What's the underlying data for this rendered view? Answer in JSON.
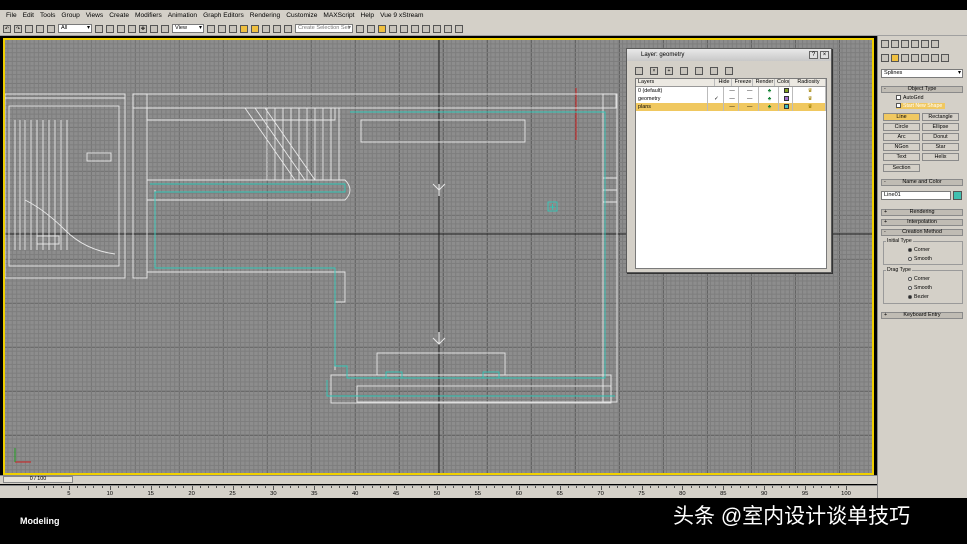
{
  "menu": [
    "File",
    "Edit",
    "Tools",
    "Group",
    "Views",
    "Create",
    "Modifiers",
    "Animation",
    "Graph Editors",
    "Rendering",
    "Customize",
    "MAXScript",
    "Help",
    "Vue 9 xStream"
  ],
  "toolbar": {
    "filter_value": "All",
    "viewcoord_value": "View",
    "selection_set_placeholder": "Create Selection Set"
  },
  "layer_window": {
    "title": "Layer: geometry",
    "columns": [
      "Layers",
      "Hide",
      "Freeze",
      "Render",
      "Color",
      "Radiosity"
    ],
    "rows": [
      {
        "name": "0 (default)",
        "hide": "—",
        "freeze": "—",
        "color": "#80a020",
        "current": false,
        "selected": false
      },
      {
        "name": "geometry",
        "hide": "—",
        "freeze": "—",
        "color": "#a070d0",
        "current": true,
        "selected": false
      },
      {
        "name": "plans",
        "hide": "—",
        "freeze": "—",
        "color": "#40c0c0",
        "current": false,
        "selected": true
      }
    ],
    "check_mark": "✓"
  },
  "command_panel": {
    "category": "Splines",
    "object_type": {
      "title": "Object Type",
      "autogrid": "AutoGrid",
      "start_new_shape": "Start New Shape",
      "buttons": [
        "Line",
        "Rectangle",
        "Circle",
        "Ellipse",
        "Arc",
        "Donut",
        "NGon",
        "Star",
        "Text",
        "Helix",
        "Section"
      ],
      "active": "Line"
    },
    "name_color": {
      "title": "Name and Color",
      "name_value": "Line01",
      "color": "#40c0b0"
    },
    "rendering": "Rendering",
    "interpolation": "Interpolation",
    "creation_method": {
      "title": "Creation Method",
      "initial_type": "Initial Type",
      "initial_options": [
        "Corner",
        "Smooth"
      ],
      "initial_selected": "Corner",
      "drag_type": "Drag Type",
      "drag_options": [
        "Corner",
        "Smooth",
        "Bezier"
      ],
      "drag_selected": "Bezier"
    },
    "keyboard_entry": "Keyboard Entry"
  },
  "timeline": {
    "frame_label": "0 / 100",
    "ticks": [
      5,
      10,
      15,
      20,
      25,
      30,
      35,
      40,
      45,
      50,
      55,
      60,
      65,
      70,
      75,
      80,
      85,
      90,
      95,
      100
    ]
  },
  "mode_label": "Modeling",
  "watermark": "头条 @室内设计谈单技巧",
  "colors": {
    "viewport_border": "#f0d000",
    "plan_lines": "#e8e8e8",
    "plan_cyan": "#30c8b8",
    "axis_x": "#d02020"
  }
}
